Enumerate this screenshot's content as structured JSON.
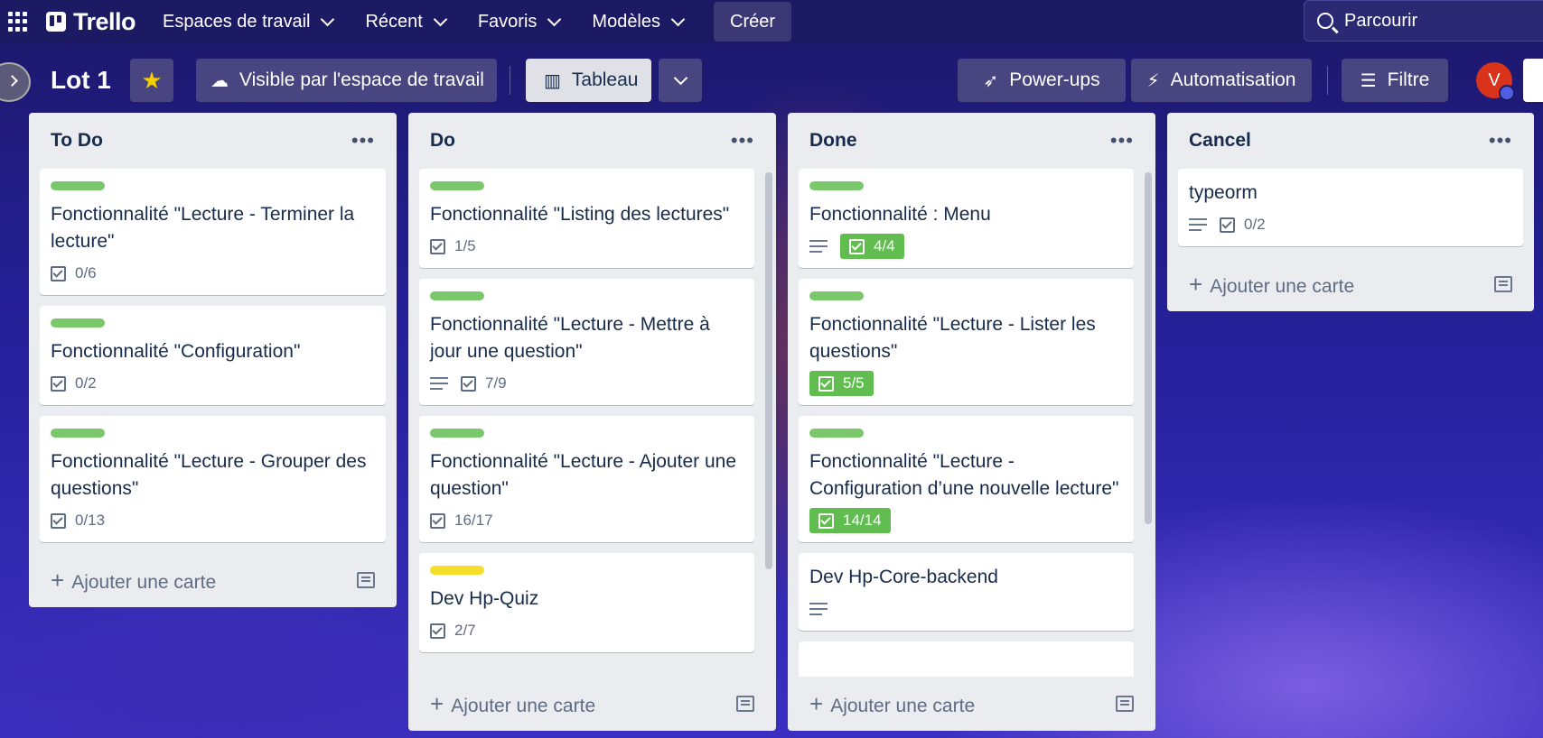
{
  "topbar": {
    "brand": "Trello",
    "nav": [
      "Espaces de travail",
      "Récent",
      "Favoris",
      "Modèles"
    ],
    "create_label": "Créer",
    "search_placeholder": "Parcourir"
  },
  "board": {
    "title": "Lot 1",
    "visibility_label": "Visible par l'espace de travail",
    "view_label": "Tableau",
    "powerups_label": "Power-ups",
    "automation_label": "Automatisation",
    "filter_label": "Filtre",
    "avatar_initial": "V"
  },
  "add_card_label": "Ajouter une carte",
  "lists": [
    {
      "title": "To Do",
      "cards": [
        {
          "label": "green",
          "title": "Fonctionnalité \"Lecture - Terminer la lecture\"",
          "checklist": "0/6"
        },
        {
          "label": "green",
          "title": "Fonctionnalité \"Configuration\"",
          "checklist": "0/2"
        },
        {
          "label": "green",
          "title": "Fonctionnalité \"Lecture - Grouper des questions\"",
          "checklist": "0/13"
        }
      ]
    },
    {
      "title": "Do",
      "cards": [
        {
          "label": "green",
          "title": "Fonctionnalité \"Listing des lectures\"",
          "checklist": "1/5"
        },
        {
          "label": "green",
          "title": "Fonctionnalité \"Lecture - Mettre à jour une question\"",
          "checklist": "7/9",
          "description": true
        },
        {
          "label": "green",
          "title": "Fonctionnalité \"Lecture - Ajouter une question\"",
          "checklist": "16/17"
        },
        {
          "label": "yellow",
          "title": "Dev Hp-Quiz",
          "checklist": "2/7"
        }
      ]
    },
    {
      "title": "Done",
      "cards": [
        {
          "label": "green",
          "title": "Fonctionnalité : Menu",
          "checklist": "4/4",
          "complete": true,
          "description": true
        },
        {
          "label": "green",
          "title": "Fonctionnalité \"Lecture - Lister les questions\"",
          "checklist": "5/5",
          "complete": true
        },
        {
          "label": "green",
          "title": "Fonctionnalité \"Lecture - Configuration d’une nouvelle lecture\"",
          "checklist": "14/14",
          "complete": true
        },
        {
          "title": "Dev Hp-Core-backend",
          "description": true
        }
      ]
    },
    {
      "title": "Cancel",
      "cards": [
        {
          "title": "typeorm",
          "checklist": "0/2",
          "description": true
        }
      ]
    }
  ],
  "colors": {
    "label_green": "#7bc86c",
    "label_yellow": "#f5dd29",
    "complete_badge": "#61bd4f",
    "topbar": "#1d1a64"
  }
}
